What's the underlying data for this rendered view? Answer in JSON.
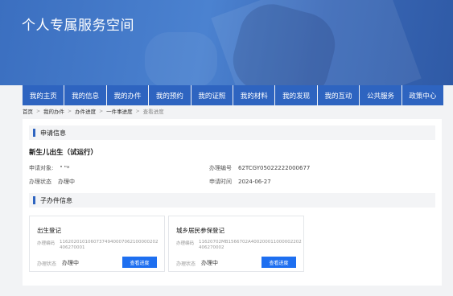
{
  "site": {
    "title": "个人专属服务空间"
  },
  "nav": [
    "我的主页",
    "我的信息",
    "我的办件",
    "我的预约",
    "我的证照",
    "我的材料",
    "我的发现",
    "我的互动",
    "公共服务",
    "政策中心"
  ],
  "breadcrumb": [
    "首页",
    "我的办件",
    "办件进度",
    "一件事进度",
    "查看进度"
  ],
  "application": {
    "section_label": "申请信息",
    "title": "新生儿出生（试运行）",
    "applicant_label": "申请对象:",
    "applicant_value": "\" \"*",
    "status_label": "办理状态",
    "status_value": "办理中",
    "number_label": "办理编号",
    "number_value": "62TCGY05022222000677",
    "date_label": "申请时间",
    "date_value": "2024-06-27"
  },
  "sub_items": {
    "section_label": "子办件信息",
    "cards": [
      {
        "title": "出生登记",
        "number_label": "办理编码",
        "number_line1": "11620201010607374940007062100000202",
        "number_line2": "406270001",
        "status_label": "办理状态",
        "status_value": "办理中",
        "button": "查看进度"
      },
      {
        "title": "城乡居民参保登记",
        "number_label": "办理编码",
        "number_line1": "11620702MB1566702A400200011000002202",
        "number_line2": "406270002",
        "status_label": "办理状态",
        "status_value": "办理中",
        "button": "查看进度"
      }
    ]
  }
}
